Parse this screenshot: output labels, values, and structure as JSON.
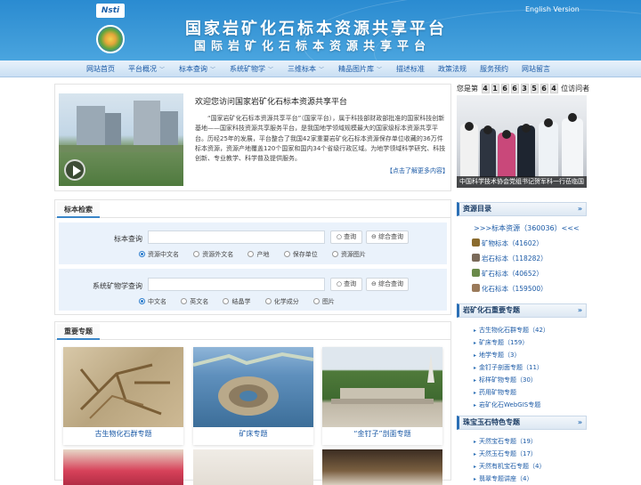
{
  "header": {
    "logo_text": "Nsti",
    "title_cn": "国家岩矿化石标本资源共享平台",
    "title_cn2": "国际岩矿化石标本资源共享平台",
    "english_link": "English Version"
  },
  "nav": {
    "items": [
      {
        "label": "网站首页"
      },
      {
        "label": "平台概况",
        "dropdown": true
      },
      {
        "label": "标本查询",
        "dropdown": true
      },
      {
        "label": "系统矿物学",
        "dropdown": true
      },
      {
        "label": "三维标本",
        "dropdown": true
      },
      {
        "label": "精品图片库",
        "dropdown": true
      },
      {
        "label": "描述标准"
      },
      {
        "label": "政策法规"
      },
      {
        "label": "服务预约"
      },
      {
        "label": "网站留言"
      }
    ]
  },
  "intro": {
    "title": "欢迎您访问国家岩矿化石标本资源共享平台",
    "text": "“国家岩矿化石标本资源共享平台”（国家平台），属于科技部财政部批准的国家科技创新基地——国家科技资源共享服务平台，是我国地学领域规模最大的国家级标本资源共享平台。历经25年的发展，平台整合了我国42家重要岩矿化石标本资源保存单位收藏的36万件标本资源，资源产地覆盖120个国家和国内34个省级行政区域。为地学领域科学研究、科技创新、专业教学、科学普及提供服务。",
    "more": "【点击了解更多内容】"
  },
  "visitor": {
    "prefix": "您是第",
    "digits": [
      "4",
      "1",
      "6",
      "6",
      "3",
      "5",
      "6",
      "4"
    ],
    "suffix": "位访问者"
  },
  "news": {
    "caption": "中国科学技术协会党组书记贺军科一行莅临国"
  },
  "search": {
    "tab": "标本检索",
    "row1": {
      "label": "标本查询",
      "query_btn": "查询",
      "combo_btn": "综合查询",
      "options": [
        "资源中文名",
        "资源外文名",
        "产地",
        "保存单位",
        "资源图片"
      ],
      "selected": 0
    },
    "row2": {
      "label": "系统矿物学查询",
      "query_btn": "查询",
      "combo_btn": "综合查询",
      "options": [
        "中文名",
        "英文名",
        "结晶学",
        "化学成分",
        "图片"
      ],
      "selected": 0
    }
  },
  "topics": {
    "tab": "重要专题",
    "cards": [
      {
        "label": "古生物化石群专题"
      },
      {
        "label": "矿床专题"
      },
      {
        "label": "“金钉子”剖面专题"
      }
    ]
  },
  "sidebar": {
    "resources_header": "资源目录",
    "resources_total": ">>>标本资源（360036）<<<",
    "resources": [
      {
        "label": "矿物标本（41602）",
        "color": "#8a6b2e"
      },
      {
        "label": "岩石标本（118282）",
        "color": "#7a6a5a"
      },
      {
        "label": "矿石标本（40652）",
        "color": "#6a8a4a"
      },
      {
        "label": "化石标本（159500）",
        "color": "#9a7a5a"
      }
    ],
    "important_header": "岩矿化石重要专题",
    "important": [
      "古生物化石群专题（42）",
      "矿床专题（159）",
      "地学专题（3）",
      "金钉子剖面专题（11）",
      "标样矿物专题（30）",
      "药用矿物专题",
      "岩矿化石WebGIS专题"
    ],
    "jewel_header": "珠宝玉石特色专题",
    "jewel": [
      "天然宝石专题（19）",
      "天然玉石专题（17）",
      "天然有机宝石专题（4）",
      "翡翠专题讲座（4）"
    ]
  }
}
